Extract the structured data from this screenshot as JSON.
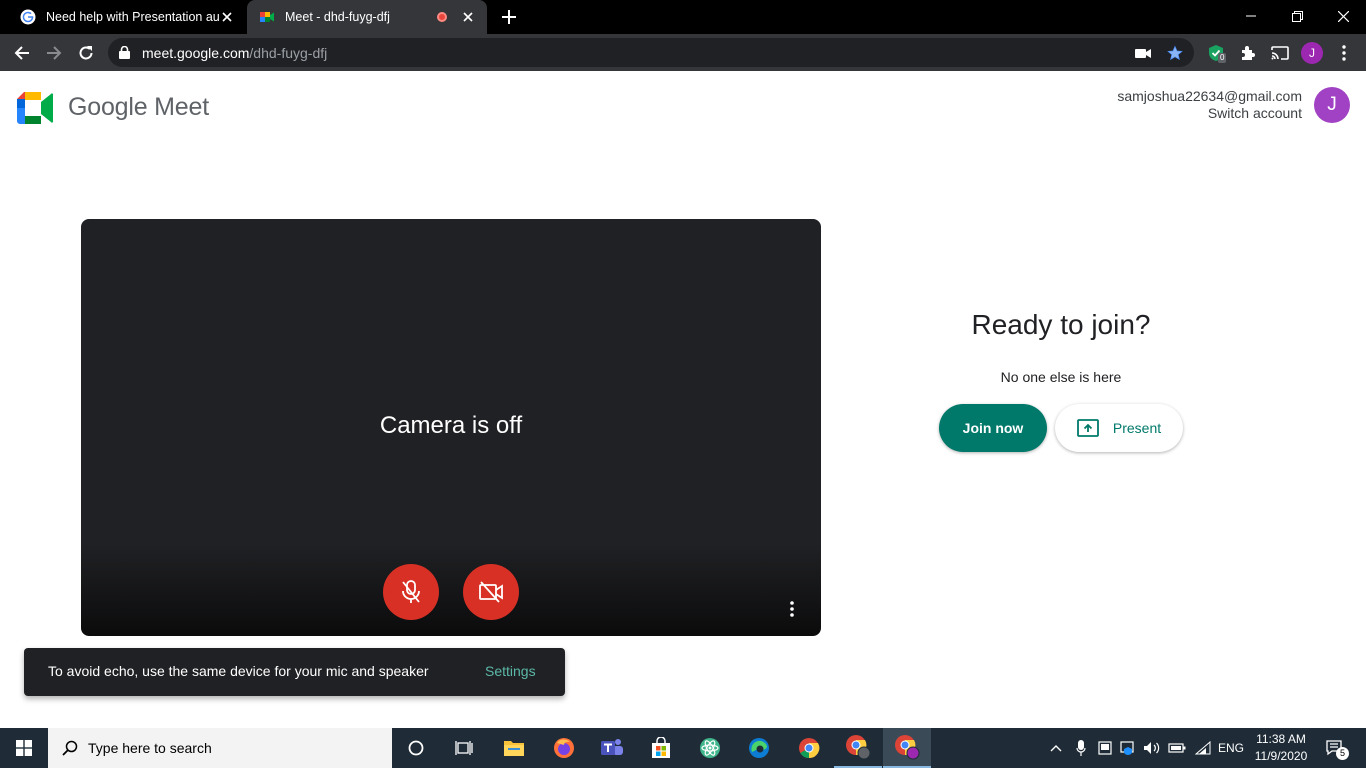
{
  "browser": {
    "tabs": [
      {
        "title": "Need help with Presentation aud"
      },
      {
        "title": "Meet - dhd-fuyg-dfj"
      }
    ],
    "url_host": "meet.google.com",
    "url_path": "/dhd-fuyg-dfj",
    "extension_badge": "0",
    "profile_initial": "J"
  },
  "meet": {
    "brand_name": "Google Meet",
    "account_email": "samjoshua22634@gmail.com",
    "switch_account": "Switch account",
    "avatar_initial": "J",
    "preview": {
      "camera_status": "Camera is off"
    },
    "ready_title": "Ready to join?",
    "participants_status": "No one else is here",
    "join_label": "Join now",
    "present_label": "Present",
    "snackbar": {
      "message": "To avoid echo, use the same device for your mic and speaker",
      "action": "Settings"
    }
  },
  "taskbar": {
    "search_placeholder": "Type here to search",
    "language": "ENG",
    "time": "11:38 AM",
    "date": "11/9/2020",
    "notification_count": "5"
  },
  "colors": {
    "join_button": "#00796b",
    "mic_cam_off": "#d93025",
    "avatar": "#a142c4"
  }
}
